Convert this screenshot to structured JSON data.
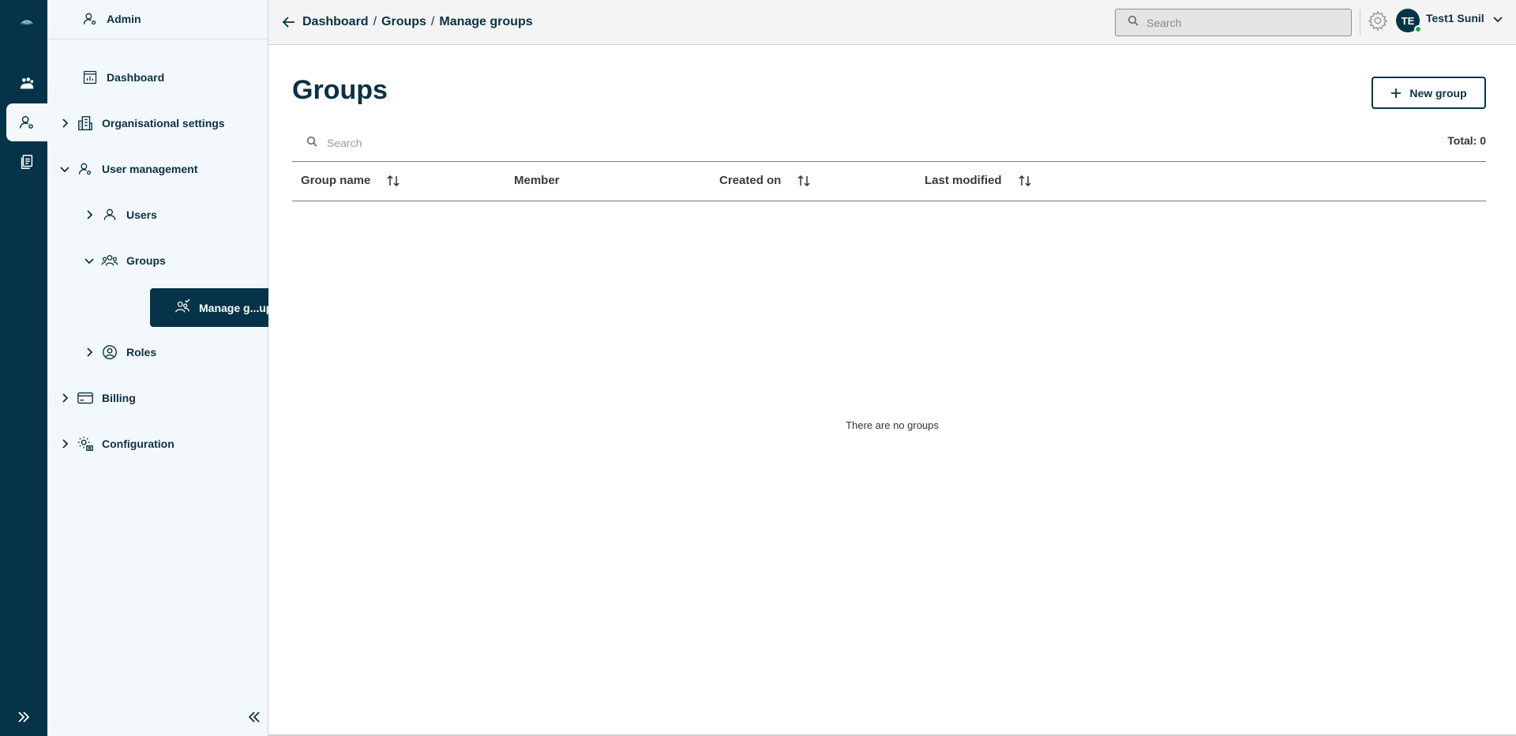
{
  "rail": {
    "items": [
      {
        "icon": "logo-icon"
      },
      {
        "icon": "people-group-icon"
      },
      {
        "icon": "admin-user-icon",
        "active": true
      },
      {
        "icon": "documents-icon"
      }
    ]
  },
  "sidenav": {
    "admin_label": "Admin",
    "items": {
      "dashboard": "Dashboard",
      "org_settings": "Organisational settings",
      "user_management": "User management",
      "users": "Users",
      "groups": "Groups",
      "manage_groups": "Manage g...ups",
      "roles": "Roles",
      "billing": "Billing",
      "configuration": "Configuration"
    }
  },
  "topbar": {
    "breadcrumb": [
      "Dashboard",
      "Groups",
      "Manage groups"
    ],
    "breadcrumb_sep": "/",
    "search_placeholder": "Search",
    "avatar_initials": "TE",
    "username": "Test1 Sunil"
  },
  "main": {
    "title": "Groups",
    "new_group_label": "New group",
    "search_placeholder": "Search",
    "total_label": "Total: 0",
    "columns": {
      "group_name": "Group name",
      "member": "Member",
      "created_on": "Created on",
      "last_modified": "Last modified"
    },
    "empty_text": "There are no groups"
  },
  "colors": {
    "primary": "#053347",
    "nav_bg": "#f3f8fc",
    "status_online": "#2e9c3f"
  }
}
